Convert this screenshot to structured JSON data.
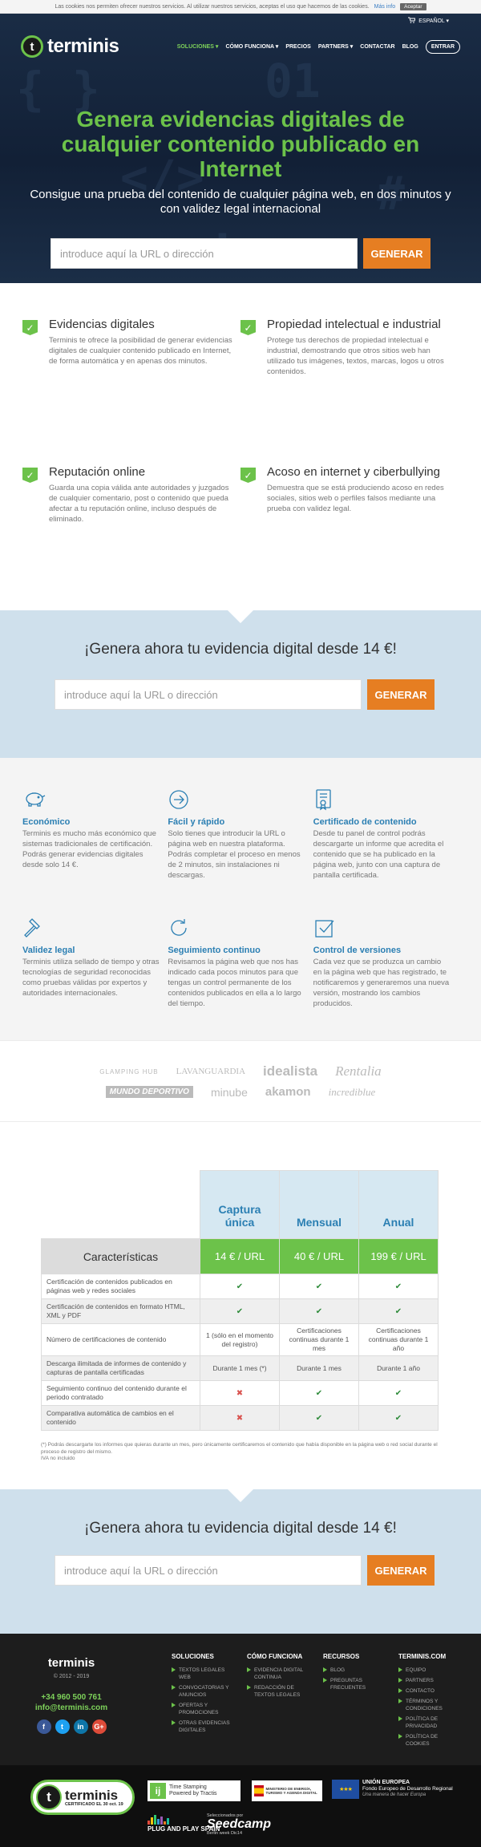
{
  "cookie": {
    "text": "Las cookies nos permiten ofrecer nuestros servicios. Al utilizar nuestros servicios, aceptas el uso que hacemos de las cookies.",
    "more": "Más info",
    "accept": "Aceptar"
  },
  "topbar": {
    "cart_icon": "cart-icon",
    "language": "ESPAÑOL"
  },
  "brand": {
    "logo_letter": "t",
    "name": "terminis"
  },
  "nav": {
    "items": [
      {
        "label": "SOLUCIONES",
        "dropdown": true,
        "active": true
      },
      {
        "label": "CÓMO FUNCIONA",
        "dropdown": true,
        "active": false
      },
      {
        "label": "PRECIOS",
        "dropdown": false,
        "active": false
      },
      {
        "label": "PARTNERS",
        "dropdown": true,
        "active": false
      },
      {
        "label": "CONTACTAR",
        "dropdown": false,
        "active": false
      },
      {
        "label": "BLOG",
        "dropdown": false,
        "active": false
      }
    ],
    "login": "ENTRAR"
  },
  "hero": {
    "title": "Genera evidencias digitales de cualquier contenido publicado en Internet",
    "subtitle": "Consigue una prueba del contenido de cualquier página web, en dos minutos y con validez legal internacional",
    "input_placeholder": "introduce aquí la URL o dirección",
    "button": "GENERAR"
  },
  "features": [
    {
      "title": "Evidencias digitales",
      "text": "Terminis te ofrece la posibilidad de generar evidencias digitales de cualquier contenido publicado en Internet, de forma automática y en apenas dos minutos."
    },
    {
      "title": "Propiedad intelectual e industrial",
      "text": "Protege tus derechos de propiedad intelectual e industrial, demostrando que otros sitios web han utilizado tus imágenes, textos, marcas, logos u otros contenidos."
    },
    {
      "title": "Reputación online",
      "text": "Guarda una copia válida ante autoridades y juzgados de cualquier comentario, post o contenido que pueda afectar a tu reputación online, incluso después de eliminado."
    },
    {
      "title": "Acoso en internet y ciberbullying",
      "text": "Demuestra que se está produciendo acoso en redes sociales, sitios web o perfiles falsos mediante una prueba con validez legal."
    }
  ],
  "cta": {
    "title": "¡Genera ahora tu evidencia digital desde 14 €!",
    "input_placeholder": "introduce aquí la URL o dirección",
    "button": "GENERAR"
  },
  "benefits": [
    {
      "icon": "piggy-bank-icon",
      "title": "Económico",
      "text": "Terminis es mucho más económico que sistemas tradicionales de certificación. Podrás generar evidencias digitales desde solo 14 €."
    },
    {
      "icon": "arrow-circle-icon",
      "title": "Fácil y rápido",
      "text": "Solo tienes que introducir la URL o página web en nuestra plataforma. Podrás completar el proceso en menos de 2 minutos, sin instalaciones ni descargas."
    },
    {
      "icon": "certificate-icon",
      "title": "Certificado de contenido",
      "text": "Desde tu panel de control podrás descargarte un informe que acredita el contenido que se ha publicado en la página web, junto con una captura de pantalla certificada."
    },
    {
      "icon": "gavel-icon",
      "title": "Validez legal",
      "text": "Terminis utiliza sellado de tiempo y otras tecnologías de seguridad reconocidas como pruebas válidas por expertos y autoridades internacionales."
    },
    {
      "icon": "refresh-icon",
      "title": "Seguimiento continuo",
      "text": "Revisamos la página web que nos has indicado cada pocos minutos para que tengas un control permanente de los contenidos publicados en ella a lo largo del tiempo."
    },
    {
      "icon": "checkbox-icon",
      "title": "Control de versiones",
      "text": "Cada vez que se produzca un cambio en la página web que has registrado, te notificaremos y generaremos una nueva versión, mostrando los cambios producidos."
    }
  ],
  "clients": {
    "row1": [
      "GLAMPING HUB",
      "LAVANGUARDIA",
      "idealista",
      "Rentalia"
    ],
    "row2": [
      "MUNDO DEPORTIVO",
      "minube",
      "akamon",
      "incrediblue"
    ]
  },
  "pricing": {
    "plans": [
      {
        "name": "Captura única",
        "price": "14 € / URL"
      },
      {
        "name": "Mensual",
        "price": "40 € / URL"
      },
      {
        "name": "Anual",
        "price": "199 € / URL"
      }
    ],
    "features_header": "Características",
    "rows": [
      {
        "label": "Certificación de contenidos publicados en páginas web y redes sociales",
        "values": [
          "✔",
          "✔",
          "✔"
        ]
      },
      {
        "label": "Certificación de contenidos en formato HTML, XML y PDF",
        "values": [
          "✔",
          "✔",
          "✔"
        ]
      },
      {
        "label": "Número de certificaciones de contenido",
        "values": [
          "1 (sólo en el momento del registro)",
          "Certificaciones continuas durante 1 mes",
          "Certificaciones continuas durante 1 año"
        ]
      },
      {
        "label": "Descarga ilimitada de informes de contenido y capturas de pantalla certificadas",
        "values": [
          "Durante 1 mes (*)",
          "Durante 1 mes",
          "Durante 1 año"
        ]
      },
      {
        "label": "Seguimiento continuo del contenido durante el periodo contratado",
        "values": [
          "✖",
          "✔",
          "✔"
        ]
      },
      {
        "label": "Comparativa automática de cambios en el contenido",
        "values": [
          "✖",
          "✔",
          "✔"
        ]
      }
    ],
    "note1": "(*) Podrás descargarte los informes que quieras durante un mes, pero únicamente certificaremos el contenido que había disponible en la página web o red social durante el proceso de registro del mismo.",
    "note2": "IVA no incluido"
  },
  "cta2": {
    "title": "¡Genera ahora tu evidencia digital desde 14 €!",
    "input_placeholder": "introduce aquí la URL o dirección",
    "button": "GENERAR"
  },
  "footer": {
    "logo": "terminis",
    "copyright": "© 2012 - 2019",
    "phone": "+34 960 500 761",
    "email": "info@terminis.com",
    "socials": [
      {
        "icon": "facebook-icon",
        "glyph": "f",
        "color": "#3b5998"
      },
      {
        "icon": "twitter-icon",
        "glyph": "t",
        "color": "#1da1f2"
      },
      {
        "icon": "linkedin-icon",
        "glyph": "in",
        "color": "#0e76a8"
      },
      {
        "icon": "googleplus-icon",
        "glyph": "G+",
        "color": "#dd4b39"
      }
    ],
    "columns": [
      {
        "title": "SOLUCIONES",
        "items": [
          "TEXTOS LEGALES WEB",
          "CONVOCATORIAS Y ANUNCIOS",
          "OFERTAS Y PROMOCIONES",
          "OTRAS EVIDENCIAS DIGITALES"
        ]
      },
      {
        "title": "CÓMO FUNCIONA",
        "items": [
          "EVIDENCIA DIGITAL CONTINUA",
          "REDACCIÓN DE TEXTOS LEGALES"
        ]
      },
      {
        "title": "RECURSOS",
        "items": [
          "BLOG",
          "PREGUNTAS FRECUENTES"
        ]
      },
      {
        "title": "TERMINIS.COM",
        "items": [
          "EQUIPO",
          "PARTNERS",
          "CONTACTO",
          "TÉRMINOS Y CONDICIONES",
          "POLÍTICA DE PRIVACIDAD",
          "POLÍTICA DE COOKIES"
        ]
      }
    ]
  },
  "badges": {
    "cert_name": "terminis",
    "cert_text": "CERTIFICADO EL 30 oct. 19",
    "timestamp_line1": "Time Stamping",
    "timestamp_line2": "Powered by Tractis",
    "ministry": "MINISTERIO DE ENERGÍA, TURISMO Y AGENDA DIGITAL",
    "eu_title": "UNIÓN EUROPEA",
    "eu_fund": "Fondo Europeo de Desarrollo Regional",
    "eu_motto": "Una manera de hacer Europa",
    "plugplay": "PLUG AND PLAY SPAIN",
    "seed_pre": "Seleccionados por",
    "seed_name": "Seedcamp",
    "seed_post": "Berlin week Dic14"
  },
  "colors": {
    "green": "#6cc24a",
    "orange": "#e67e22",
    "blue": "#2b7fb3",
    "navy": "#14233a",
    "cta_bg": "#cfe0ec"
  }
}
